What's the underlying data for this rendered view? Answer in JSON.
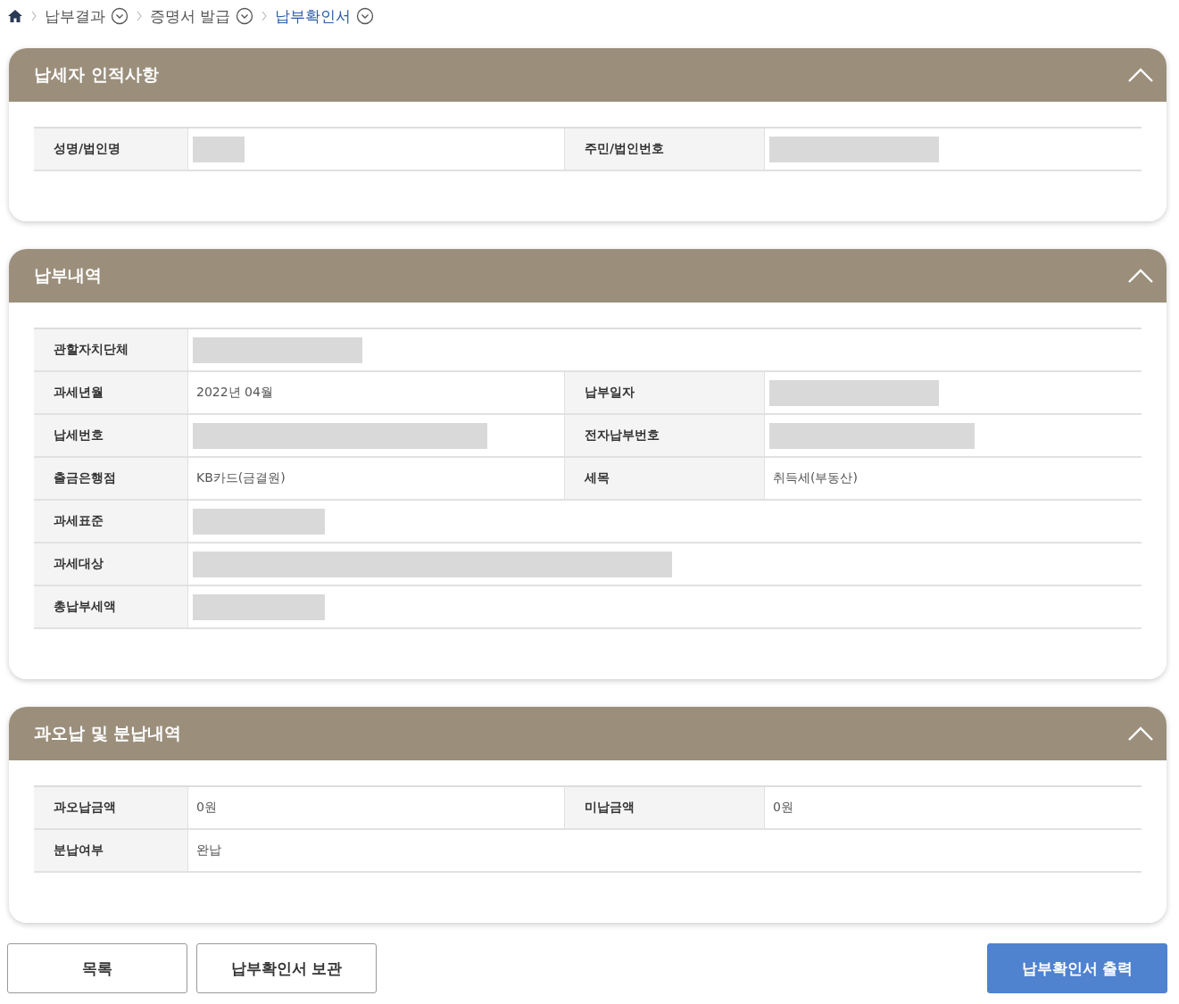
{
  "breadcrumb": [
    {
      "label": "납부결과",
      "selected": false
    },
    {
      "label": "증명서 발급",
      "selected": false
    },
    {
      "label": "납부확인서",
      "selected": true
    }
  ],
  "sections": [
    {
      "title": "납세자 인적사항",
      "expanded": true,
      "rows": [
        {
          "fields": [
            {
              "label": "성명/법인명",
              "redacted": true
            },
            {
              "label": "주민/법인번호",
              "redacted": true
            }
          ]
        }
      ]
    },
    {
      "title": "납부내역",
      "expanded": true,
      "rows": [
        {
          "fields": [
            {
              "label": "관할자치단체",
              "redacted": true
            }
          ]
        },
        {
          "fields": [
            {
              "label": "과세년월",
              "value": "2022년 04월"
            },
            {
              "label": "납부일자",
              "redacted": true
            }
          ]
        },
        {
          "fields": [
            {
              "label": "납세번호",
              "redacted": true
            },
            {
              "label": "전자납부번호",
              "redacted": true
            }
          ]
        },
        {
          "fields": [
            {
              "label": "출금은행점",
              "value": "KB카드(금결원)"
            },
            {
              "label": "세목",
              "value": "취득세(부동산)"
            }
          ]
        },
        {
          "fields": [
            {
              "label": "과세표준",
              "redacted": true
            }
          ]
        },
        {
          "fields": [
            {
              "label": "과세대상",
              "redacted": true
            }
          ]
        },
        {
          "fields": [
            {
              "label": "총납부세액",
              "redacted": true
            }
          ]
        }
      ]
    },
    {
      "title": "과오납 및 분납내역",
      "expanded": true,
      "rows": [
        {
          "fields": [
            {
              "label": "과오납금액",
              "value": "0원"
            },
            {
              "label": "미납금액",
              "value": "0원"
            }
          ]
        },
        {
          "fields": [
            {
              "label": "분납여부",
              "value": "완납"
            }
          ]
        }
      ]
    }
  ],
  "buttons": [
    {
      "label": "목록",
      "kind": "secondary"
    },
    {
      "label": "납부확인서 보관",
      "kind": "secondary"
    },
    {
      "label": "납부확인서 출력",
      "kind": "primary"
    }
  ]
}
